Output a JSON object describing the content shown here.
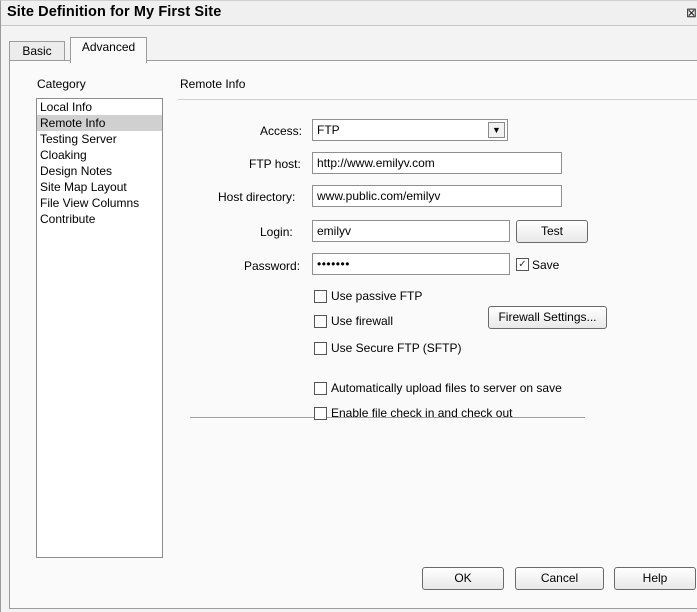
{
  "window": {
    "title": "Site Definition for My First Site"
  },
  "tabs": [
    {
      "label": "Basic"
    },
    {
      "label": "Advanced"
    }
  ],
  "category": {
    "heading": "Category",
    "items": [
      "Local Info",
      "Remote Info",
      "Testing Server",
      "Cloaking",
      "Design Notes",
      "Site Map Layout",
      "File View Columns",
      "Contribute"
    ],
    "selected": "Remote Info"
  },
  "section": {
    "title": "Remote Info"
  },
  "form": {
    "access_label": "Access:",
    "access_value": "FTP",
    "ftp_host_label": "FTP host:",
    "ftp_host_value": "http://www.emilyv.com",
    "host_dir_label": "Host directory:",
    "host_dir_value": "www.public.com/emilyv",
    "login_label": "Login:",
    "login_value": "emilyv",
    "password_label": "Password:",
    "password_value": "•••••••",
    "test_label": "Test",
    "save_label": "Save",
    "save_checked": true,
    "passive_ftp_label": "Use passive FTP",
    "firewall_label": "Use firewall",
    "firewall_settings_label": "Firewall Settings...",
    "sftp_label": "Use Secure FTP (SFTP)",
    "auto_upload_label": "Automatically upload files to server on save",
    "check_in_out_label": "Enable file check in and check out"
  },
  "footer": {
    "ok_label": "OK",
    "cancel_label": "Cancel",
    "help_label": "Help"
  },
  "icons": {
    "close": "close-icon",
    "dropdown": "chevron-down-icon",
    "checkmark": "checkmark-icon"
  }
}
